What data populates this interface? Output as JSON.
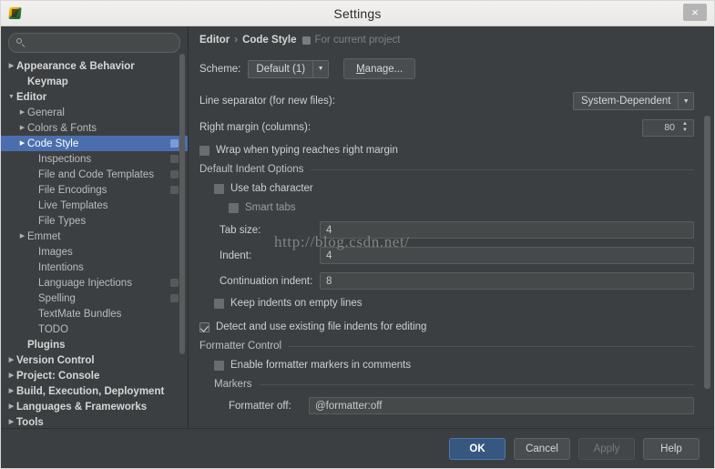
{
  "window": {
    "title": "Settings",
    "app_icon": "intellij-idea-icon",
    "close_label": "×"
  },
  "search": {
    "placeholder": "",
    "value": "",
    "icon": "search-icon"
  },
  "sidebar": {
    "items": [
      {
        "label": "Appearance & Behavior",
        "arrow": "▶",
        "bold": true,
        "indent": 0,
        "selected": false,
        "badge": false
      },
      {
        "label": "Keymap",
        "arrow": "",
        "bold": true,
        "indent": 1,
        "selected": false,
        "badge": false
      },
      {
        "label": "Editor",
        "arrow": "▼",
        "bold": true,
        "indent": 0,
        "selected": false,
        "badge": false
      },
      {
        "label": "General",
        "arrow": "▶",
        "bold": false,
        "indent": 1,
        "selected": false,
        "badge": false
      },
      {
        "label": "Colors & Fonts",
        "arrow": "▶",
        "bold": false,
        "indent": 1,
        "selected": false,
        "badge": false
      },
      {
        "label": "Code Style",
        "arrow": "▶",
        "bold": false,
        "indent": 1,
        "selected": true,
        "badge": true
      },
      {
        "label": "Inspections",
        "arrow": "",
        "bold": false,
        "indent": 2,
        "selected": false,
        "badge": true
      },
      {
        "label": "File and Code Templates",
        "arrow": "",
        "bold": false,
        "indent": 2,
        "selected": false,
        "badge": true
      },
      {
        "label": "File Encodings",
        "arrow": "",
        "bold": false,
        "indent": 2,
        "selected": false,
        "badge": true
      },
      {
        "label": "Live Templates",
        "arrow": "",
        "bold": false,
        "indent": 2,
        "selected": false,
        "badge": false
      },
      {
        "label": "File Types",
        "arrow": "",
        "bold": false,
        "indent": 2,
        "selected": false,
        "badge": false
      },
      {
        "label": "Emmet",
        "arrow": "▶",
        "bold": false,
        "indent": 1,
        "selected": false,
        "badge": false
      },
      {
        "label": "Images",
        "arrow": "",
        "bold": false,
        "indent": 2,
        "selected": false,
        "badge": false
      },
      {
        "label": "Intentions",
        "arrow": "",
        "bold": false,
        "indent": 2,
        "selected": false,
        "badge": false
      },
      {
        "label": "Language Injections",
        "arrow": "",
        "bold": false,
        "indent": 2,
        "selected": false,
        "badge": true
      },
      {
        "label": "Spelling",
        "arrow": "",
        "bold": false,
        "indent": 2,
        "selected": false,
        "badge": true
      },
      {
        "label": "TextMate Bundles",
        "arrow": "",
        "bold": false,
        "indent": 2,
        "selected": false,
        "badge": false
      },
      {
        "label": "TODO",
        "arrow": "",
        "bold": false,
        "indent": 2,
        "selected": false,
        "badge": false
      },
      {
        "label": "Plugins",
        "arrow": "",
        "bold": true,
        "indent": 1,
        "selected": false,
        "badge": false
      },
      {
        "label": "Version Control",
        "arrow": "▶",
        "bold": true,
        "indent": 0,
        "selected": false,
        "badge": false
      },
      {
        "label": "Project: Console",
        "arrow": "▶",
        "bold": true,
        "indent": 0,
        "selected": false,
        "badge": false
      },
      {
        "label": "Build, Execution, Deployment",
        "arrow": "▶",
        "bold": true,
        "indent": 0,
        "selected": false,
        "badge": false
      },
      {
        "label": "Languages & Frameworks",
        "arrow": "▶",
        "bold": true,
        "indent": 0,
        "selected": false,
        "badge": false
      },
      {
        "label": "Tools",
        "arrow": "▶",
        "bold": true,
        "indent": 0,
        "selected": false,
        "badge": false
      }
    ]
  },
  "breadcrumb": {
    "parent": "Editor",
    "separator": "›",
    "current": "Code Style",
    "scope_icon": "project-scope-icon",
    "scope_text": "For current project"
  },
  "scheme": {
    "label": "Scheme:",
    "value": "Default (1)",
    "dropdown_icon": "chevron-down-icon",
    "manage_label_underlined": "M",
    "manage_label_rest": "anage..."
  },
  "line_separator": {
    "label": "Line separator (for new files):",
    "value": "System-Dependent",
    "dropdown_icon": "chevron-down-icon"
  },
  "right_margin": {
    "label": "Right margin (columns):",
    "value": "80",
    "up_icon": "▲",
    "down_icon": "▼"
  },
  "wrap_option": {
    "label": "Wrap when typing reaches right margin",
    "checked": false
  },
  "default_indent_options": {
    "section_title": "Default Indent Options",
    "use_tab_character": {
      "label": "Use tab character",
      "checked": false
    },
    "smart_tabs": {
      "label": "Smart tabs",
      "checked": false,
      "disabled": true
    },
    "tab_size": {
      "label": "Tab size:",
      "value": "4"
    },
    "indent": {
      "label": "Indent:",
      "value": "4"
    },
    "continuation_indent": {
      "label": "Continuation indent:",
      "value": "8"
    },
    "keep_indents": {
      "label": "Keep indents on empty lines",
      "checked": false
    }
  },
  "detect_indents": {
    "label": "Detect and use existing file indents for editing",
    "checked": true
  },
  "formatter_control": {
    "section_title": "Formatter Control",
    "enable_markers": {
      "label": "Enable formatter markers in comments",
      "checked": false,
      "disabled": true
    },
    "markers_title": "Markers",
    "formatter_off": {
      "label": "Formatter off:",
      "value": "@formatter:off"
    }
  },
  "watermark": {
    "text": "http://blog.csdn.net/"
  },
  "footer": {
    "ok": "OK",
    "cancel": "Cancel",
    "apply": "Apply",
    "help": "Help"
  },
  "colors": {
    "accent_selection": "#4b6eaf",
    "default_button": "#365880",
    "panel_bg": "#3c3f41",
    "titlebar_bg": "#f2f1f0"
  }
}
